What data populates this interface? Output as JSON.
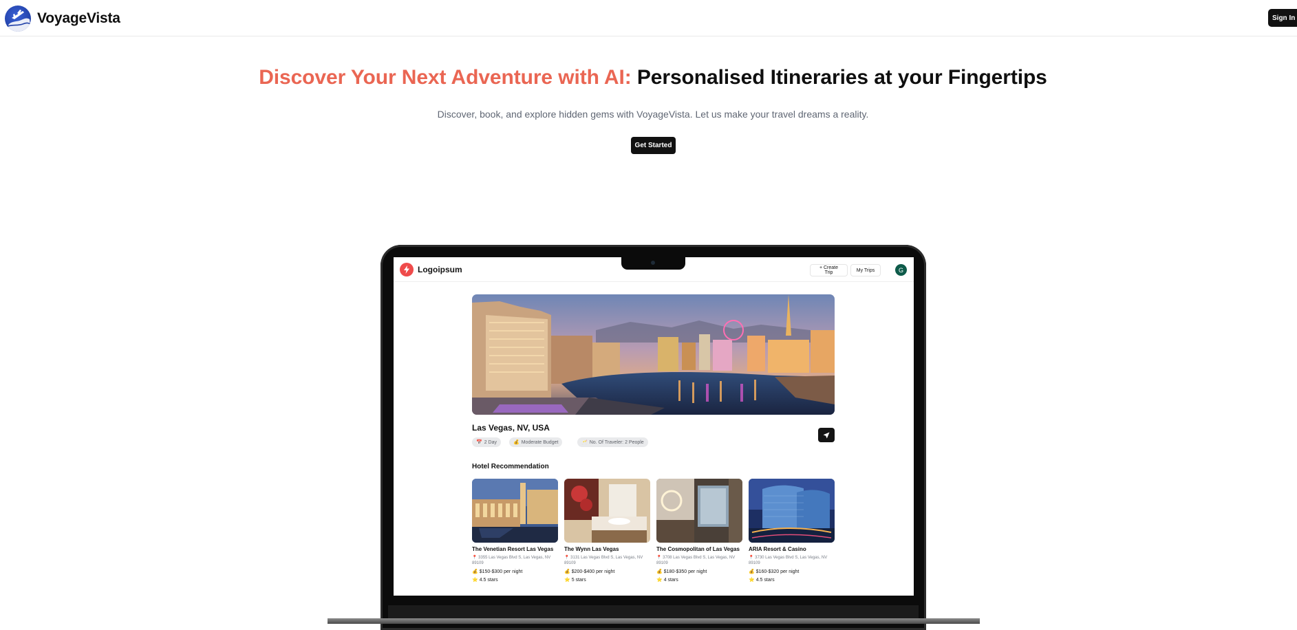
{
  "header": {
    "brand_name": "VoyageVista",
    "signin_label": "Sign In"
  },
  "hero": {
    "title_accent": "Discover Your Next Adventure with AI:",
    "title_rest": "Personalised Itineraries at your Fingertips",
    "subtitle": "Discover, book, and explore hidden gems with VoyageVista. Let us make your travel dreams a reality.",
    "cta_label": "Get Started"
  },
  "preview": {
    "brand_name": "Logoipsum",
    "create_trip_label": "+ Create Trip",
    "my_trips_label": "My Trips",
    "avatar_initial": "G",
    "trip": {
      "location": "Las Vegas, NV, USA",
      "chips": [
        {
          "icon": "📅",
          "label": "2 Day"
        },
        {
          "icon": "💰",
          "label": "Moderate Budget"
        },
        {
          "icon": "🥂",
          "label": "No. Of Traveler: 2 People"
        }
      ]
    },
    "hotel_section_title": "Hotel Recommendation",
    "hotels": [
      {
        "name": "The Venetian Resort Las Vegas",
        "address": "3355 Las Vegas Blvd S, Las Vegas, NV 89109",
        "price": "$150-$300 per night",
        "rating": "4.5 stars"
      },
      {
        "name": "The Wynn Las Vegas",
        "address": "3131 Las Vegas Blvd S, Las Vegas, NV 89109",
        "price": "$200-$400 per night",
        "rating": "5 stars"
      },
      {
        "name": "The Cosmopolitan of Las Vegas",
        "address": "3708 Las Vegas Blvd S, Las Vegas, NV 89109",
        "price": "$180-$350 per night",
        "rating": "4 stars"
      },
      {
        "name": "ARIA Resort & Casino",
        "address": "3730 Las Vegas Blvd S, Las Vegas, NV 89109",
        "price": "$160-$320 per night",
        "rating": "4.5 stars"
      }
    ],
    "icons": {
      "pin": "📍",
      "price": "💰",
      "rating": "⭐"
    }
  }
}
